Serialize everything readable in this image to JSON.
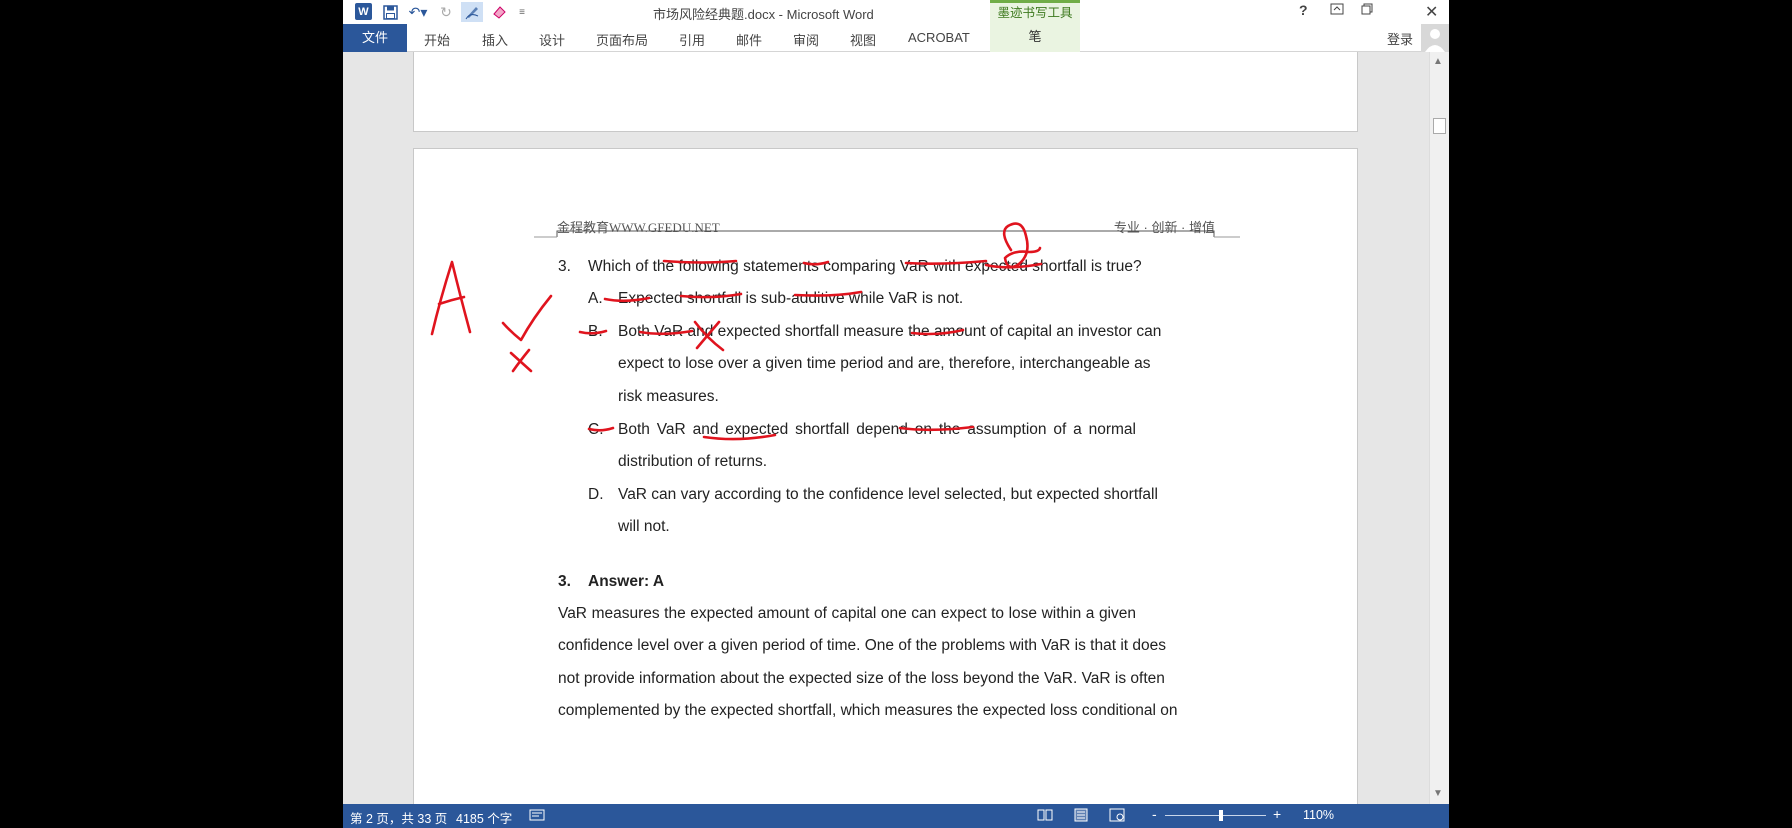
{
  "window": {
    "title": "市场风险经典题.docx - Microsoft Word",
    "contextual_tab": "墨迹书写工具",
    "help_icon": "?",
    "controls": [
      "restore-ribbon-icon",
      "restore-icon",
      "close-icon"
    ]
  },
  "quick_access": {
    "logo": "W",
    "icons": [
      "save-icon",
      "undo-icon",
      "redo-icon",
      "pen-icon",
      "eraser-icon",
      "customize-icon"
    ]
  },
  "ribbon": {
    "file_label": "文件",
    "tabs": [
      "开始",
      "插入",
      "设计",
      "页面布局",
      "引用",
      "邮件",
      "审阅",
      "视图",
      "ACROBAT"
    ],
    "pen_tab": "笔",
    "signin": "登录"
  },
  "page_header": {
    "left": "金程教育WWW.GFEDU.NET",
    "right": "专业 · 创新 · 增值"
  },
  "question": {
    "number": "3.",
    "text": "Which of the following statements comparing VaR with expected shortfall is true?",
    "options": [
      {
        "letter": "A.",
        "lines": [
          "Expected shortfall is sub-additive while VaR is not."
        ]
      },
      {
        "letter": "B.",
        "lines": [
          "Both VaR and expected shortfall measure the amount of capital an investor can",
          "expect to lose over a given time period and are, therefore, interchangeable as",
          "risk measures."
        ]
      },
      {
        "letter": "C.",
        "lines": [
          "Both VaR and expected shortfall depend on the assumption of a normal",
          "distribution of returns."
        ]
      },
      {
        "letter": "D.",
        "lines": [
          "VaR can vary according to the confidence level selected, but expected shortfall",
          "will not."
        ]
      }
    ]
  },
  "answer": {
    "number": "3.",
    "title": "Answer: A",
    "lines": [
      "VaR measures the expected amount of capital one can expect to lose within a given",
      "confidence level over a given period of time. One of the problems with VaR is that it does",
      "not provide information about the expected size of the loss beyond the VaR. VaR is often",
      "complemented by the expected shortfall, which measures the expected loss conditional on"
    ]
  },
  "ink_annotations": {
    "big_letter": "A",
    "color": "#e0141e"
  },
  "status": {
    "page": "第 2 页，共 33 页",
    "words": "4185 个字",
    "zoom": "110%",
    "zoom_minus": "-",
    "zoom_plus": "+"
  },
  "colors": {
    "word_blue": "#2b579a",
    "ink_green": "#70ad47",
    "ink_red": "#e0141e"
  }
}
